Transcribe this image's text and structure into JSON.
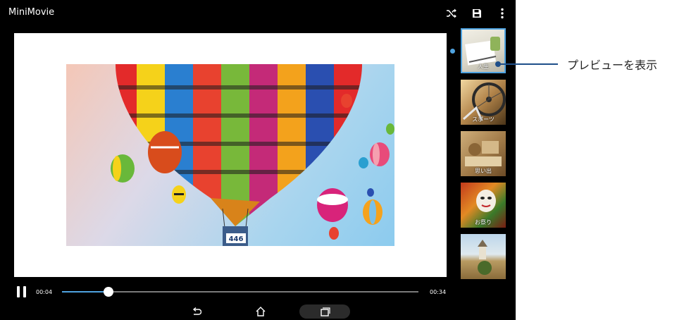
{
  "app": {
    "title": "MiniMovie"
  },
  "toolbar": {
    "icons": [
      "shuffle-icon",
      "save-icon",
      "more-vert-icon"
    ]
  },
  "player": {
    "elapsed": "00:04",
    "duration": "00:34",
    "progress": 0.13,
    "photo_caption": "446"
  },
  "themes": [
    {
      "label": "人生",
      "selected": true
    },
    {
      "label": "スポーツ",
      "selected": false
    },
    {
      "label": "思い出",
      "selected": false
    },
    {
      "label": "お祭り",
      "selected": false
    },
    {
      "label": "",
      "selected": false
    }
  ],
  "navbar": {
    "icons": [
      "back-icon",
      "home-icon",
      "recents-icon"
    ]
  },
  "callout": {
    "text": "プレビューを表示"
  },
  "colors": {
    "accent": "#4fa3e0",
    "callout": "#1f4f8a"
  }
}
